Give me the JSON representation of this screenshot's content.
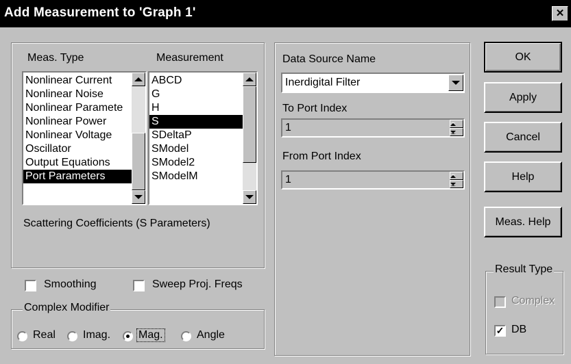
{
  "dialog": {
    "title": "Add Measurement to 'Graph 1'",
    "close_glyph": "✕"
  },
  "meas_type": {
    "label": "Meas. Type",
    "items": [
      "Nonlinear Current",
      "Nonlinear Noise",
      "Nonlinear Paramete",
      "Nonlinear Power",
      "Nonlinear Voltage",
      "Oscillator",
      "Output Equations",
      "Port Parameters"
    ],
    "selected": "Port Parameters"
  },
  "measurement": {
    "label": "Measurement",
    "items": [
      "ABCD",
      "G",
      "H",
      "S",
      "SDeltaP",
      "SModel",
      "SModel2",
      "SModelM"
    ],
    "selected": "S"
  },
  "description": "Scattering Coefficients (S Parameters)",
  "options": {
    "smoothing": {
      "label": "Smoothing",
      "checked": false
    },
    "sweep_proj_freqs": {
      "label": "Sweep Proj. Freqs",
      "checked": false
    }
  },
  "complex_modifier": {
    "label": "Complex Modifier",
    "options": [
      "Real",
      "Imag.",
      "Mag.",
      "Angle"
    ],
    "selected": "Mag."
  },
  "data_source": {
    "label": "Data Source Name",
    "value": "Inerdigital Filter"
  },
  "to_port": {
    "label": "To Port Index",
    "value": "1"
  },
  "from_port": {
    "label": "From Port Index",
    "value": "1"
  },
  "buttons": {
    "ok": "OK",
    "apply": "Apply",
    "cancel": "Cancel",
    "help": "Help",
    "meas_help": "Meas. Help"
  },
  "result_type": {
    "label": "Result Type",
    "complex": {
      "label": "Complex",
      "checked": false,
      "enabled": false
    },
    "db": {
      "label": "DB",
      "checked": true,
      "enabled": true
    }
  },
  "check_glyph": "✓"
}
